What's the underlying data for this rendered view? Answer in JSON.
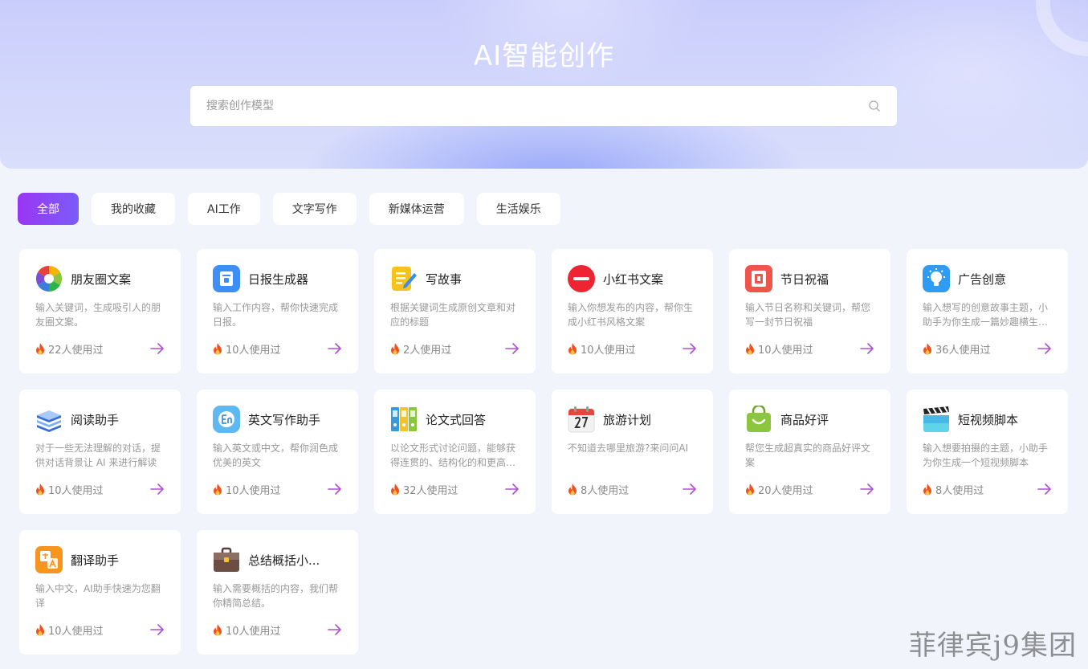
{
  "hero": {
    "title": "AI智能创作",
    "search_placeholder": "搜索创作模型"
  },
  "tabs": [
    {
      "label": "全部",
      "active": true
    },
    {
      "label": "我的收藏",
      "active": false
    },
    {
      "label": "AI工作",
      "active": false
    },
    {
      "label": "文字写作",
      "active": false
    },
    {
      "label": "新媒体运营",
      "active": false
    },
    {
      "label": "生活娱乐",
      "active": false
    }
  ],
  "cards": [
    {
      "title": "朋友圈文案",
      "desc": "输入关键词，生成吸引人的朋友圈文案。",
      "usage": "22人使用过",
      "icon": "aperture-icon"
    },
    {
      "title": "日报生成器",
      "desc": "输入工作内容，帮你快速完成日报。",
      "usage": "10人使用过",
      "icon": "daily-report-icon"
    },
    {
      "title": "写故事",
      "desc": "根据关键词生成原创文章和对应的标题",
      "usage": "2人使用过",
      "icon": "write-story-icon"
    },
    {
      "title": "小红书文案",
      "desc": "输入你想发布的内容，帮你生成小红书风格文案",
      "usage": "10人使用过",
      "icon": "xiaohongshu-icon"
    },
    {
      "title": "节日祝福",
      "desc": "输入节日名称和关键词，帮您写一封节日祝福",
      "usage": "10人使用过",
      "icon": "festival-icon"
    },
    {
      "title": "广告创意",
      "desc": "输入想写的创意故事主题，小助手为你生成一篇妙趣横生的广告创意",
      "usage": "36人使用过",
      "icon": "lightbulb-icon"
    },
    {
      "title": "阅读助手",
      "desc": "对于一些无法理解的对话，提供对话背景让 AI 来进行解读",
      "usage": "10人使用过",
      "icon": "books-icon"
    },
    {
      "title": "英文写作助手",
      "desc": "输入英文或中文，帮你润色成优美的英文",
      "usage": "10人使用过",
      "icon": "english-icon"
    },
    {
      "title": "论文式回答",
      "desc": "以论文形式讨论问题，能够获得连贯的、结构化的和更高质量的回答",
      "usage": "32人使用过",
      "icon": "binders-icon"
    },
    {
      "title": "旅游计划",
      "desc": "不知道去哪里旅游?来问问AI",
      "usage": "8人使用过",
      "icon": "calendar-icon"
    },
    {
      "title": "商品好评",
      "desc": "帮您生成超真实的商品好评文案",
      "usage": "20人使用过",
      "icon": "shopping-bag-icon"
    },
    {
      "title": "短视频脚本",
      "desc": "输入想要拍摄的主题，小助手为你生成一个短视频脚本",
      "usage": "8人使用过",
      "icon": "clapperboard-icon"
    },
    {
      "title": "翻译助手",
      "desc": "输入中文，AI助手快速为您翻译",
      "usage": "10人使用过",
      "icon": "translate-icon"
    },
    {
      "title": "总结概括小...",
      "desc": "输入需要概括的内容，我们帮你精简总结。",
      "usage": "10人使用过",
      "icon": "briefcase-icon"
    }
  ],
  "watermark": "菲律宾j9集团",
  "colors": {
    "accent": "#8a45f6",
    "arrow": "#b24fd9",
    "fire": "#f0501e"
  }
}
